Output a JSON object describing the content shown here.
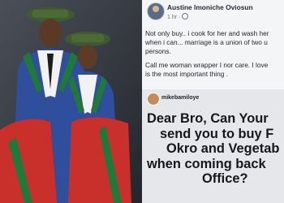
{
  "post": {
    "author": "Austine Imoniche Oviosun",
    "time": "1 hr",
    "body_lines": [
      "Not only buy.. i cook for her and wash her",
      "when i can... marriage is a union of two u",
      "persons."
    ],
    "body_lines_2": [
      "Call me woman wrapper I nor care. I love",
      "is the most important thing ."
    ]
  },
  "embed": {
    "username": "mikebamiloye",
    "lines": [
      "Dear Bro,  Can Your",
      "send you to buy F",
      "Okro and Vegetab",
      "when coming back",
      "Office?"
    ]
  },
  "colors": {
    "gown_blue": "#2f4e9c",
    "sash_red": "#c9302c",
    "sash_green": "#1f7a3a",
    "cap_green": "#3f5a2f"
  }
}
